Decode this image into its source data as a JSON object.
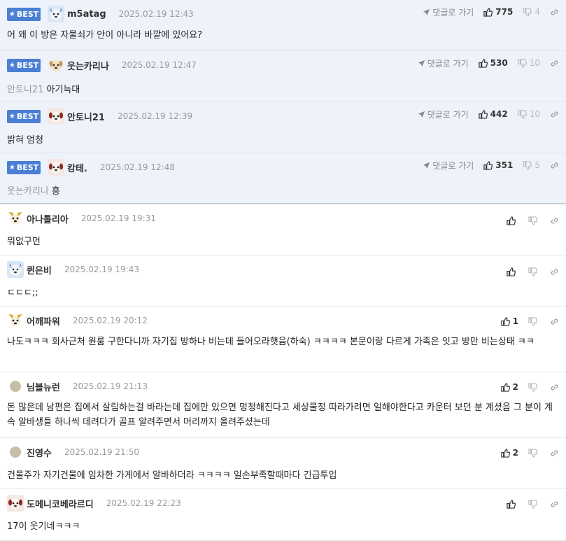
{
  "best_badge": "BEST",
  "reply_label": "댓글로 가기",
  "comments": [
    {
      "nick": "m5atag",
      "date": "2025.02.19 12:43",
      "mention": "",
      "text": "어 왜 이 방은 자물쇠가 안이 아니라 바깥에 있어요?",
      "up": "775",
      "down": "4",
      "best": true,
      "avatar": "blue-dog"
    },
    {
      "nick": "웃는카리나",
      "date": "2025.02.19 12:47",
      "mention": "안토니21",
      "text": "아기늑대",
      "up": "530",
      "down": "10",
      "best": true,
      "avatar": "cream-dog"
    },
    {
      "nick": "안토니21",
      "date": "2025.02.19 12:39",
      "mention": "",
      "text": "밝혀 엄청",
      "up": "442",
      "down": "10",
      "best": true,
      "avatar": "red-dog"
    },
    {
      "nick": "캉테.",
      "date": "2025.02.19 12:48",
      "mention": "웃는카리나",
      "text": "흥",
      "up": "351",
      "down": "5",
      "best": true,
      "avatar": "red-dog"
    },
    {
      "nick": "아나톨리아",
      "date": "2025.02.19 19:31",
      "mention": "",
      "text": "뭐없구먼",
      "up": "",
      "down": "",
      "best": false,
      "avatar": "yellow-dog"
    },
    {
      "nick": "퀸은비",
      "date": "2025.02.19 19:43",
      "mention": "",
      "text": "ㄷㄷㄷ;;",
      "up": "",
      "down": "",
      "best": false,
      "avatar": "blue-dog"
    },
    {
      "nick": "어깨파워",
      "date": "2025.02.19 20:12",
      "mention": "",
      "text": "나도ㅋㅋㅋ 회사근처 원룸 구한다니까 자기집 방하나 비는데 들어오라햇음(하숙) ㅋㅋㅋㅋ 본문이랑 다르게 가족은 잇고 방만 비는상태 ㅋㅋ",
      "up": "1",
      "down": "",
      "best": false,
      "avatar": "yellow-dog"
    },
    {
      "nick": "님블뉴런",
      "date": "2025.02.19 21:13",
      "mention": "",
      "text": "돈 많은데 남편은 집에서 살림하는걸 바라는데 집에만 있으면 멍청해진다고 세상물정 따라가려면 일해야한다고 카운터 보던 분 계셨음 그 분이 계속 알바생들 하나씩 데려다가 골프 알려주면서 머리까지 올려주셨는데",
      "up": "2",
      "down": "",
      "best": false,
      "avatar": "dot"
    },
    {
      "nick": "진영수",
      "date": "2025.02.19 21:50",
      "mention": "",
      "text": "건물주가 자기건물에 임차한 가게에서 알바하더라 ㅋㅋㅋㅋ 일손부족할때마다 긴급투입",
      "up": "2",
      "down": "",
      "best": false,
      "avatar": "dot"
    },
    {
      "nick": "도메니코베라르디",
      "date": "2025.02.19 22:23",
      "mention": "",
      "text": "17이 웃기네ㅋㅋㅋ",
      "up": "",
      "down": "",
      "best": false,
      "avatar": "red-dog"
    }
  ],
  "colors": {
    "badge": "#4a7fd4",
    "best_bg": "#eef2fa"
  }
}
